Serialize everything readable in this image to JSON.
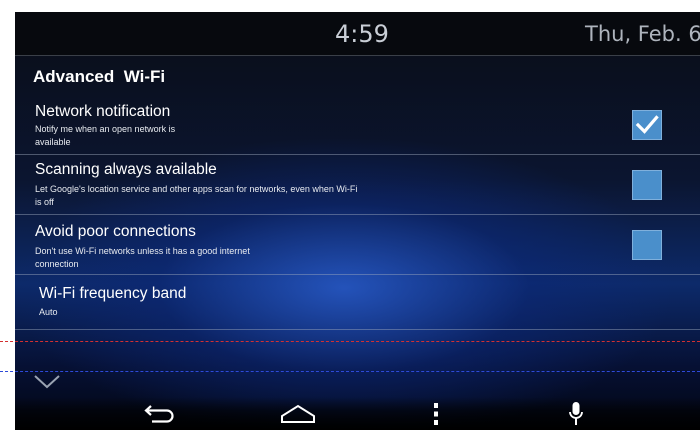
{
  "status_bar": {
    "time": "4:59",
    "date": "Thu, Feb. 6"
  },
  "page": {
    "title": "Advanced  Wi-Fi"
  },
  "settings": [
    {
      "title": "Network notification",
      "summary": "Notify me when an open network is\navailable",
      "checked": true
    },
    {
      "title": "Scanning always available",
      "summary": "Let Google's location service and other apps scan for networks,  even when Wi-Fi\nis off",
      "checked": false
    },
    {
      "title": "Avoid poor connections",
      "summary": "Don't use Wi-Fi networks  unless it has a good internet\nconnection",
      "checked": false
    },
    {
      "title": "Wi-Fi frequency band",
      "summary": "Auto"
    }
  ],
  "navigation": {
    "icons": [
      "chevron-down-icon",
      "back-icon",
      "home-icon",
      "menu-icon",
      "microphone-icon"
    ]
  },
  "colors": {
    "checkbox_fill": "#4a8fcb",
    "accent_dash_red": "#d33030",
    "accent_dash_blue": "#2e4ad8",
    "status_bar_bg": "#07090e"
  }
}
